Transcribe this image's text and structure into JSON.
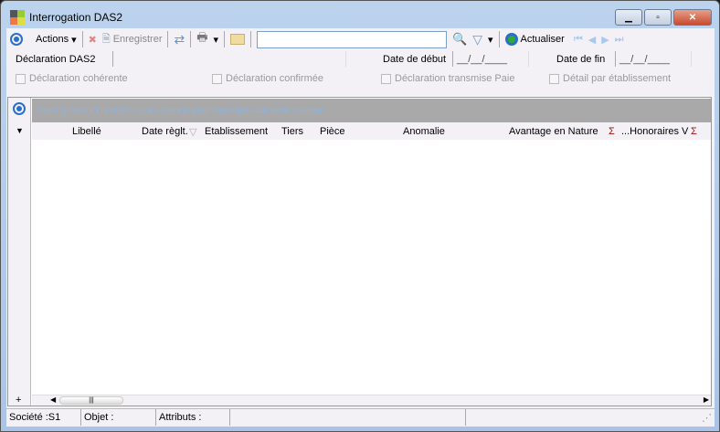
{
  "window": {
    "title": "Interrogation DAS2",
    "minimize": "▁",
    "maximize": "▫",
    "close": "✕"
  },
  "toolbar": {
    "actions": "Actions",
    "save": "Enregistrer",
    "search_value": "",
    "refresh": "Actualiser"
  },
  "form": {
    "declaration_label": "Déclaration DAS2",
    "date_debut_label": "Date de début",
    "date_debut_value": "__/__/____",
    "date_fin_label": "Date de fin",
    "date_fin_value": "__/__/____"
  },
  "checkboxes": {
    "coherente": "Déclaration cohérente",
    "confirmee": "Déclaration  confirmée",
    "transmise": "Déclaration transmise Paie",
    "detail": "Détail par établissement"
  },
  "grid": {
    "group_hint": "Faire glisser ici l'entête d'une colonne pour regrouper sur cette colonne.",
    "columns": [
      "Libellé",
      "Date règlt.",
      "Etablissement",
      "Tiers",
      "Pièce",
      "Anomalie",
      "Avantage en Nature",
      "...Honoraires V"
    ],
    "sigma": "Σ"
  },
  "status": {
    "societe": "Société :S1",
    "objet": "Objet :",
    "attributs": "Attributs :"
  }
}
